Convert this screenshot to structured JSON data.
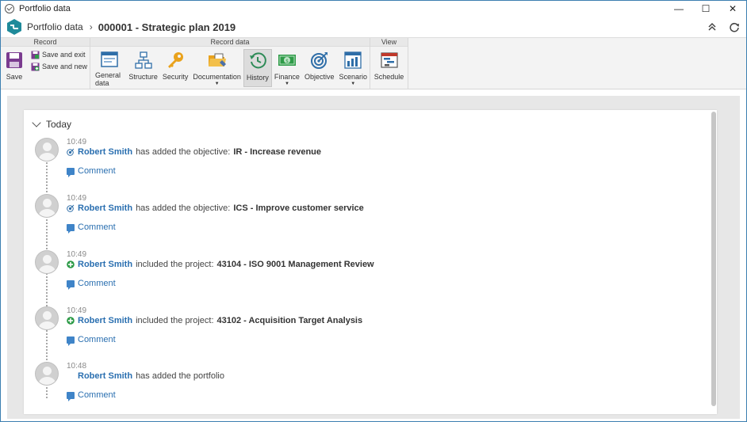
{
  "window": {
    "title": "Portfolio data"
  },
  "header": {
    "breadcrumb": "Portfolio data",
    "record_title": "000001 - Strategic plan 2019"
  },
  "ribbon": {
    "groups": [
      {
        "label": "Record"
      },
      {
        "label": "Record data"
      },
      {
        "label": "View"
      }
    ],
    "record": {
      "save": "Save",
      "save_and_exit": "Save and exit",
      "save_and_new": "Save and new"
    },
    "record_data": {
      "general_data": "General data",
      "structure": "Structure",
      "security": "Security",
      "documentation": "Documentation",
      "history": "History",
      "finance": "Finance",
      "objective": "Objective",
      "scenario": "Scenario"
    },
    "view": {
      "schedule": "Schedule"
    }
  },
  "timeline": {
    "section": "Today",
    "comment_label": "Comment",
    "entries": [
      {
        "time": "10:49",
        "icon": "objective-icon",
        "user": "Robert Smith",
        "action": "has added the objective:",
        "target": "IR - Increase revenue"
      },
      {
        "time": "10:49",
        "icon": "objective-icon",
        "user": "Robert Smith",
        "action": "has added the objective:",
        "target": "ICS - Improve customer service"
      },
      {
        "time": "10:49",
        "icon": "add-icon",
        "user": "Robert Smith",
        "action": "included the project:",
        "target": "43104 - ISO 9001 Management Review"
      },
      {
        "time": "10:49",
        "icon": "add-icon",
        "user": "Robert Smith",
        "action": "included the project:",
        "target": "43102 - Acquisition Target Analysis"
      },
      {
        "time": "10:48",
        "icon": "",
        "user": "Robert Smith",
        "action": "has added the portfolio",
        "target": ""
      }
    ]
  },
  "colors": {
    "link": "#2a6fb0",
    "accent_teal": "#1f8a9a",
    "save_purple": "#7a3b8f",
    "add_green": "#2e9b48"
  }
}
